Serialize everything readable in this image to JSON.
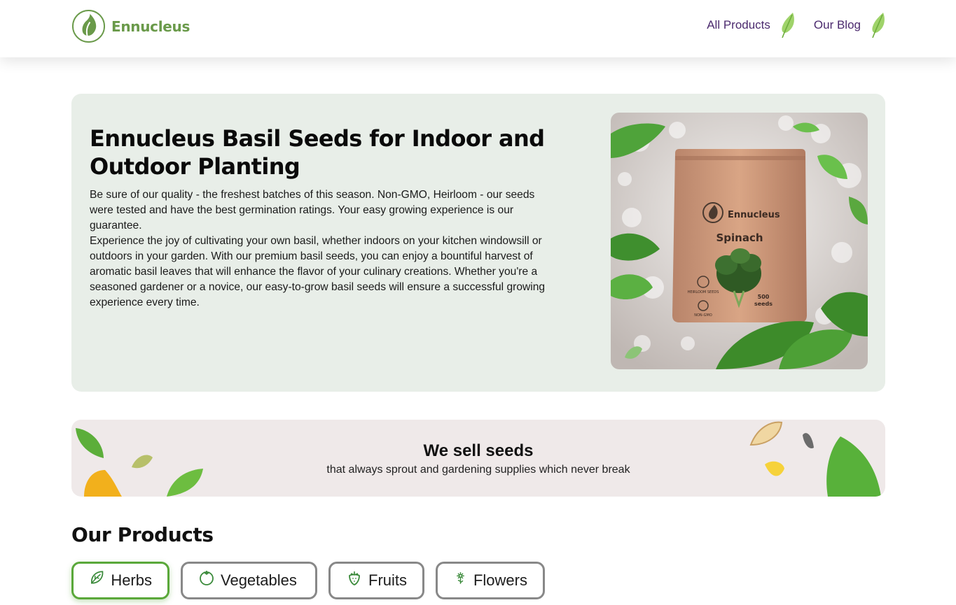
{
  "header": {
    "brand": "Ennucleus",
    "nav": [
      {
        "label": "All Products",
        "icon": "leaf-icon"
      },
      {
        "label": "Our Blog",
        "icon": "leaf-icon"
      }
    ]
  },
  "hero": {
    "title": "Ennucleus Basil Seeds for Indoor and Outdoor Planting",
    "paragraph1": "Be sure of our quality - the freshest batches of this season. Non-GMO, Heirloom - our seeds were tested and have the best germination ratings. Your easy growing experience is our guarantee.",
    "paragraph2": "Experience the joy of cultivating your own basil, whether indoors on your kitchen windowsill or outdoors in your garden. With our premium basil seeds, you can enjoy a bountiful harvest of aromatic basil leaves that will enhance the flavor of your culinary creations. Whether you're a seasoned gardener or a novice, our easy-to-grow basil seeds will ensure a successful growing experience every time.",
    "image": {
      "brand": "Ennucleus",
      "product": "Spinach",
      "count": "500",
      "unit": "seeds",
      "badge1": "HEIRLOOM SEEDS",
      "badge2": "NON-GMO"
    }
  },
  "banner": {
    "title": "We sell seeds",
    "subtitle": "that always sprout and gardening supplies which never break"
  },
  "products": {
    "title": "Our Products",
    "tabs": [
      {
        "label": "Herbs",
        "icon": "herb-leaf-icon",
        "active": true
      },
      {
        "label": "Vegetables",
        "icon": "tomato-icon",
        "active": false
      },
      {
        "label": "Fruits",
        "icon": "strawberry-icon",
        "active": false
      },
      {
        "label": "Flowers",
        "icon": "flower-icon",
        "active": false
      }
    ]
  },
  "colors": {
    "brand_green": "#6a9a4a",
    "nav_purple": "#4b2a6e",
    "hero_bg": "#e8eee8",
    "banner_bg": "#efe9e9",
    "active_tab_border": "#5aa83a"
  }
}
